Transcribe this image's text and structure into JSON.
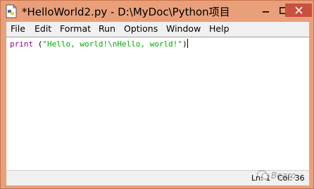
{
  "window": {
    "title": "*HelloWorld2.py - D:\\MyDoc\\Python项目",
    "icon": "python-idle-file-icon",
    "controls": {
      "minimize_icon": "minimize-icon",
      "maximize_icon": "maximize-icon",
      "close_icon": "close-icon"
    },
    "colors": {
      "frame": "#e9a07a",
      "close_button": "#c7503e"
    }
  },
  "menubar": {
    "items": [
      {
        "label": "File"
      },
      {
        "label": "Edit"
      },
      {
        "label": "Format"
      },
      {
        "label": "Run"
      },
      {
        "label": "Options"
      },
      {
        "label": "Window"
      },
      {
        "label": "Help"
      }
    ]
  },
  "editor": {
    "code": {
      "builtin": "print",
      "open": " (",
      "string": "\"Hello, world!\\nHello, world!\"",
      "close": ")"
    },
    "colors": {
      "builtin": "#900090",
      "string": "#00aa00"
    }
  },
  "statusbar": {
    "ln": "Ln: 1",
    "col": "Col: 36"
  },
  "watermark": {
    "text": "Bearo",
    "icon": "wechat-icon"
  }
}
